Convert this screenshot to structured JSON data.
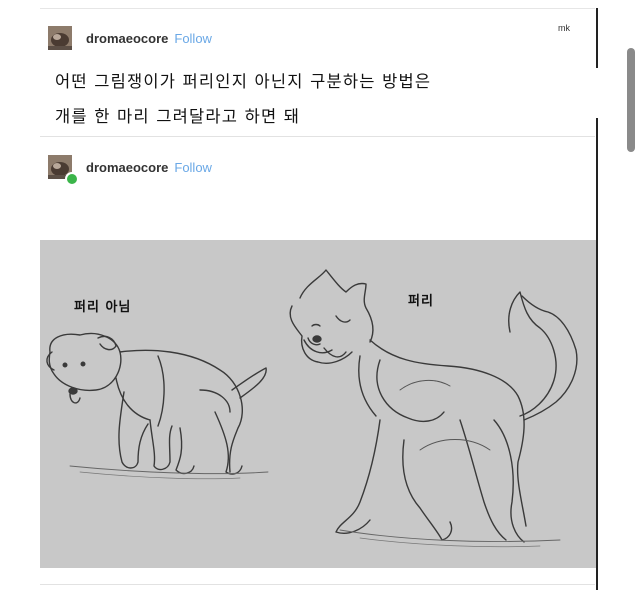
{
  "watermark": "mk",
  "posts": [
    {
      "username": "dromaeocore",
      "follow_label": "Follow",
      "text_lines": [
        "어떤 그림쟁이가 퍼리인지 아닌지 구분하는 방법은",
        "개를 한 마리 그려달라고 하면 돼"
      ]
    },
    {
      "username": "dromaeocore",
      "follow_label": "Follow",
      "image": {
        "left_label": "퍼리 아님",
        "right_label": "퍼리"
      }
    }
  ],
  "colors": {
    "follow": "#6aa8e6",
    "image_bg": "#c8c8c8",
    "online": "#3bb54a"
  }
}
